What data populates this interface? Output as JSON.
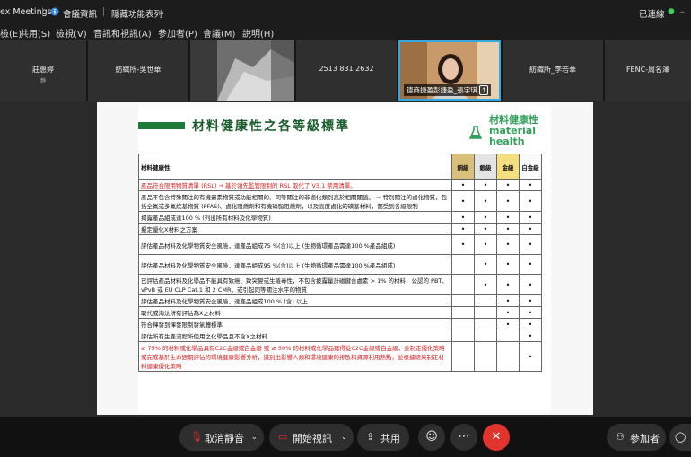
{
  "titlebar": {
    "app": "ex Meetings",
    "sep": "|",
    "meeting_info": "會議資訊",
    "hidden_features": "隱藏功能表列",
    "status": "已連線"
  },
  "menu": [
    "檢(E)",
    "共用(S)",
    "檢視(V)",
    "音訊和視訊(A)",
    "參加者(P)",
    "會議(M)",
    "說明(H)"
  ],
  "participants": [
    {
      "name": "莊惠婷",
      "sub": "靜"
    },
    {
      "name": "紡織所-吳世華"
    },
    {
      "name": ""
    },
    {
      "name": "2513 831 2632"
    },
    {
      "name": "德商捷盈彭捷盈_張宇琪"
    },
    {
      "name": "紡織所_李若華"
    },
    {
      "name": "FENC-周名澤"
    }
  ],
  "doc": {
    "title": "材料健康性之各等級標準",
    "brand_cn": "材料健康性",
    "brand_en1": "material",
    "brand_en2": "health",
    "header": {
      "label": "材料健康性",
      "copper": "銅級",
      "silver": "銀級",
      "gold": "金級",
      "platinum": "白金級"
    },
    "rows": [
      {
        "text": "產品符合限用物質清單 (RSL) → 基於領先監管限制的 RSL 取代了 V3.1 禁用清單。",
        "marks": [
          "•",
          "•",
          "•",
          "•"
        ]
      },
      {
        "text": "產品不包含特殊關注的有機畫素物質或功能相關的、同等關注的非鹵化類別高於相關閾值。 → 特別關注的鹵化物質，包括全氟或多氟烷基物質 (PFAS)、鹵化阻燃劑和有機磷脂阻燃劑，以及高度鹵化的磺基材料，都受到各級限制",
        "marks": [
          "•",
          "•",
          "•",
          "•"
        ]
      },
      {
        "text": "揭露產品組成達100 % (列出所有材料及化學物質)",
        "marks": [
          "•",
          "•",
          "•",
          "•"
        ]
      },
      {
        "text": "擬定優化X材料之方案",
        "marks": [
          "•",
          "•",
          "•",
          "•"
        ]
      },
      {
        "text": "評估產品材料及化學物質安全風險，達產品組成75 %(含)以上 (生物循環產品需達100 %產品組成)",
        "marks": [
          "•",
          "•",
          "•",
          "•"
        ]
      },
      {
        "text": "評估產品材料及化學物質安全風險，達產品組成95 %(含)以上 (生物循環產品需達100 %產品組成)",
        "marks": [
          "",
          "•",
          "•",
          "•"
        ]
      },
      {
        "text": "已評估產品材料及化學品不能具有致癌、致突變或生殖毒性，不包含披露量計磁鍵合處素 > 1% 的材料，公認的 PBT、vPvB 或 EU CLP Cat.1 和 2 CMR，或引起同等關注水平的物質",
        "marks": [
          "",
          "•",
          "•",
          "•"
        ]
      },
      {
        "text": "評估產品材料及化學物質安全風險，達產品組成100 % (含) 以上",
        "marks": [
          "",
          "",
          "•",
          "•"
        ]
      },
      {
        "text": "取代或淘汰所有評估為X之材料",
        "marks": [
          "",
          "",
          "•",
          "•"
        ]
      },
      {
        "text": "符合揮發到揮發限制發氣體標準",
        "marks": [
          "",
          "",
          "•",
          "•"
        ]
      },
      {
        "text": "評估所有生產流程所使用之化學品且不含X之材料",
        "marks": [
          "",
          "",
          "",
          "•"
        ]
      },
      {
        "text": "≥ 75% 的材料或化學品具有C2C金級或白金級 或 ≥ 50% 的材料或化學品獲得從C2C金級或白金級，並制定優化策略 或完成基於生命週期評估的環境健康影響分析，識別出影響人類和環境健康的排放和資源利用熱點，並根據結果制定材料健康優化策略",
        "marks": [
          "",
          "",
          "",
          "•"
        ]
      }
    ]
  },
  "controls": {
    "mute": "取消靜音",
    "video": "開始視訊",
    "share": "共用",
    "participants": "參加者"
  },
  "colors": {
    "accent_green": "#1f7a3a",
    "end_red": "#e0342c",
    "active_border": "#2fa9e0"
  }
}
